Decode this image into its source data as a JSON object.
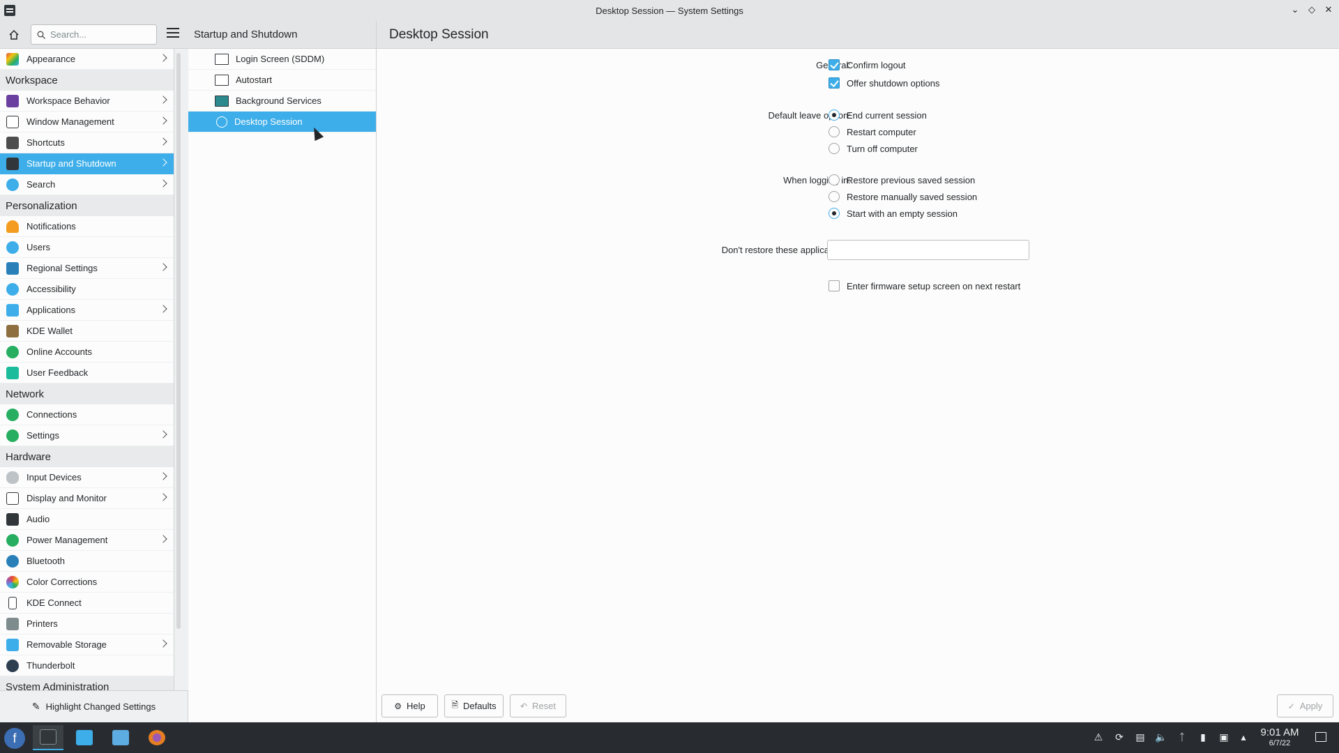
{
  "window": {
    "title": "Desktop Session — System Settings",
    "controls": [
      "minimize",
      "maximize",
      "close"
    ]
  },
  "header": {
    "search_placeholder": "Search...",
    "subtitle": "Startup and Shutdown",
    "page_title": "Desktop Session"
  },
  "sidebar": {
    "top_item": {
      "label": "Appearance",
      "icon": "appearance-icon",
      "has_children": true
    },
    "categories": {
      "workspace": "Workspace",
      "personalization": "Personalization",
      "network": "Network",
      "hardware": "Hardware",
      "sysadmin": "System Administration"
    },
    "workspace_items": [
      {
        "label": "Workspace Behavior",
        "icon": "workspace-behavior-icon",
        "has_children": true
      },
      {
        "label": "Window Management",
        "icon": "window-management-icon",
        "has_children": true
      },
      {
        "label": "Shortcuts",
        "icon": "keyboard-icon",
        "has_children": true
      },
      {
        "label": "Startup and Shutdown",
        "icon": "startup-icon",
        "has_children": true,
        "active": true
      },
      {
        "label": "Search",
        "icon": "search-icon",
        "has_children": true
      }
    ],
    "personalization_items": [
      {
        "label": "Notifications",
        "icon": "bell-icon"
      },
      {
        "label": "Users",
        "icon": "users-icon"
      },
      {
        "label": "Regional Settings",
        "icon": "regional-icon",
        "has_children": true
      },
      {
        "label": "Accessibility",
        "icon": "accessibility-icon"
      },
      {
        "label": "Applications",
        "icon": "applications-icon",
        "has_children": true
      },
      {
        "label": "KDE Wallet",
        "icon": "wallet-icon"
      },
      {
        "label": "Online Accounts",
        "icon": "online-accounts-icon"
      },
      {
        "label": "User Feedback",
        "icon": "feedback-icon"
      }
    ],
    "network_items": [
      {
        "label": "Connections",
        "icon": "connections-icon"
      },
      {
        "label": "Settings",
        "icon": "network-settings-icon",
        "has_children": true
      }
    ],
    "hardware_items": [
      {
        "label": "Input Devices",
        "icon": "mouse-icon",
        "has_children": true
      },
      {
        "label": "Display and Monitor",
        "icon": "monitor-icon",
        "has_children": true
      },
      {
        "label": "Audio",
        "icon": "audio-icon"
      },
      {
        "label": "Power Management",
        "icon": "power-icon",
        "has_children": true
      },
      {
        "label": "Bluetooth",
        "icon": "bluetooth-icon"
      },
      {
        "label": "Color Corrections",
        "icon": "color-icon"
      },
      {
        "label": "KDE Connect",
        "icon": "phone-icon"
      },
      {
        "label": "Printers",
        "icon": "printer-icon"
      },
      {
        "label": "Removable Storage",
        "icon": "usb-icon",
        "has_children": true
      },
      {
        "label": "Thunderbolt",
        "icon": "thunderbolt-icon"
      }
    ],
    "footer_label": "Highlight Changed Settings"
  },
  "sublist": {
    "items": [
      {
        "label": "Login Screen (SDDM)",
        "icon": "monitor-icon"
      },
      {
        "label": "Autostart",
        "icon": "autostart-icon"
      },
      {
        "label": "Background Services",
        "icon": "services-icon"
      },
      {
        "label": "Desktop Session",
        "icon": "session-icon",
        "active": true
      }
    ]
  },
  "form": {
    "general_label": "General:",
    "confirm_logout": {
      "label": "Confirm logout",
      "checked": true
    },
    "offer_shutdown": {
      "label": "Offer shutdown options",
      "checked": true
    },
    "leave_label": "Default leave option:",
    "leave_options": [
      {
        "label": "End current session",
        "checked": true
      },
      {
        "label": "Restart computer",
        "checked": false
      },
      {
        "label": "Turn off computer",
        "checked": false
      }
    ],
    "login_label": "When logging in:",
    "login_options": [
      {
        "label": "Restore previous saved session",
        "checked": false
      },
      {
        "label": "Restore manually saved session",
        "checked": false
      },
      {
        "label": "Start with an empty session",
        "checked": true
      }
    ],
    "exclude_label": "Don't restore these applications:",
    "exclude_value": "",
    "firmware": {
      "label": "Enter firmware setup screen on next restart",
      "checked": false
    }
  },
  "buttons": {
    "help": "Help",
    "defaults": "Defaults",
    "reset": "Reset",
    "apply": "Apply"
  },
  "taskbar": {
    "time": "9:01 AM",
    "date": "6/7/22"
  },
  "colors": {
    "accent": "#3daee9",
    "panel": "#282c30",
    "window_bg": "#eff0f1",
    "view_bg": "#fcfcfc"
  }
}
